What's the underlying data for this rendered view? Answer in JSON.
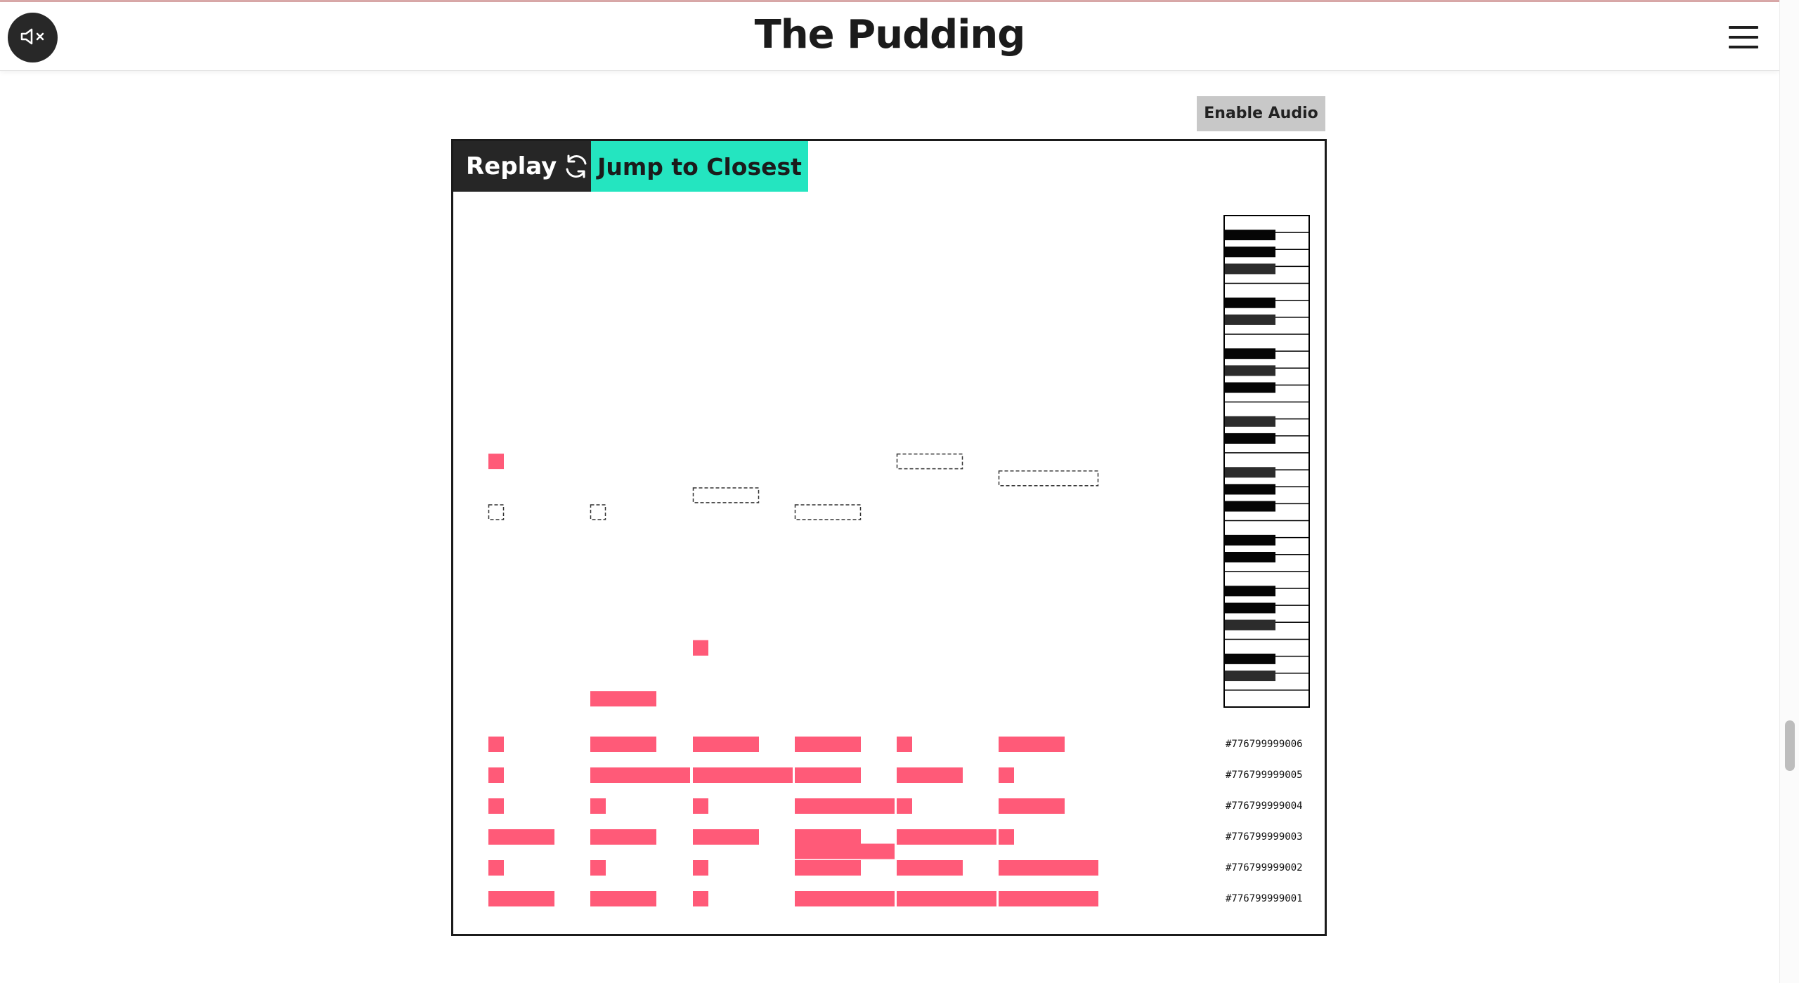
{
  "header": {
    "logo_text": "The Pudding",
    "mute_icon": "speaker-muted-icon",
    "menu_icon": "hamburger-menu-icon"
  },
  "controls": {
    "enable_audio_label": "Enable Audio",
    "replay_label": "Replay",
    "replay_icon": "refresh-icon",
    "jump_label": "Jump to Closest"
  },
  "colors": {
    "note": "#ff5a78",
    "jump_button": "#24e5c0",
    "dark": "#262626"
  },
  "piano_roll": {
    "answer_attempts": [
      {
        "id": "#776799999006",
        "notes": [
          1,
          4,
          4,
          4,
          1,
          4
        ]
      },
      {
        "id": "#776799999005",
        "notes": [
          1,
          6,
          6,
          4,
          4,
          1
        ]
      },
      {
        "id": "#776799999004",
        "notes": [
          1,
          1,
          1,
          6,
          1,
          4
        ]
      },
      {
        "id": "#776799999003",
        "notes": [
          4,
          4,
          4,
          4,
          6,
          1
        ]
      },
      {
        "id": "#776799999002",
        "notes": [
          1,
          1,
          1,
          4,
          4,
          6
        ]
      },
      {
        "id": "#776799999001",
        "notes": [
          4,
          4,
          1,
          6,
          6,
          6
        ]
      }
    ],
    "target_notes": [
      {
        "pitch": 17,
        "duration": 1
      },
      {
        "pitch": 17,
        "duration": 1
      },
      {
        "pitch": 16,
        "duration": 4
      },
      {
        "pitch": 17,
        "duration": 4
      },
      {
        "pitch": 14,
        "duration": 4
      },
      {
        "pitch": 15,
        "duration": 6
      }
    ],
    "guess_notes": [
      {
        "pitch": 14,
        "duration": 1
      },
      {
        "pitch": 28,
        "duration": 4
      },
      {
        "pitch": 25,
        "duration": 1
      },
      {
        "pitch": 37,
        "duration": 6
      }
    ]
  }
}
